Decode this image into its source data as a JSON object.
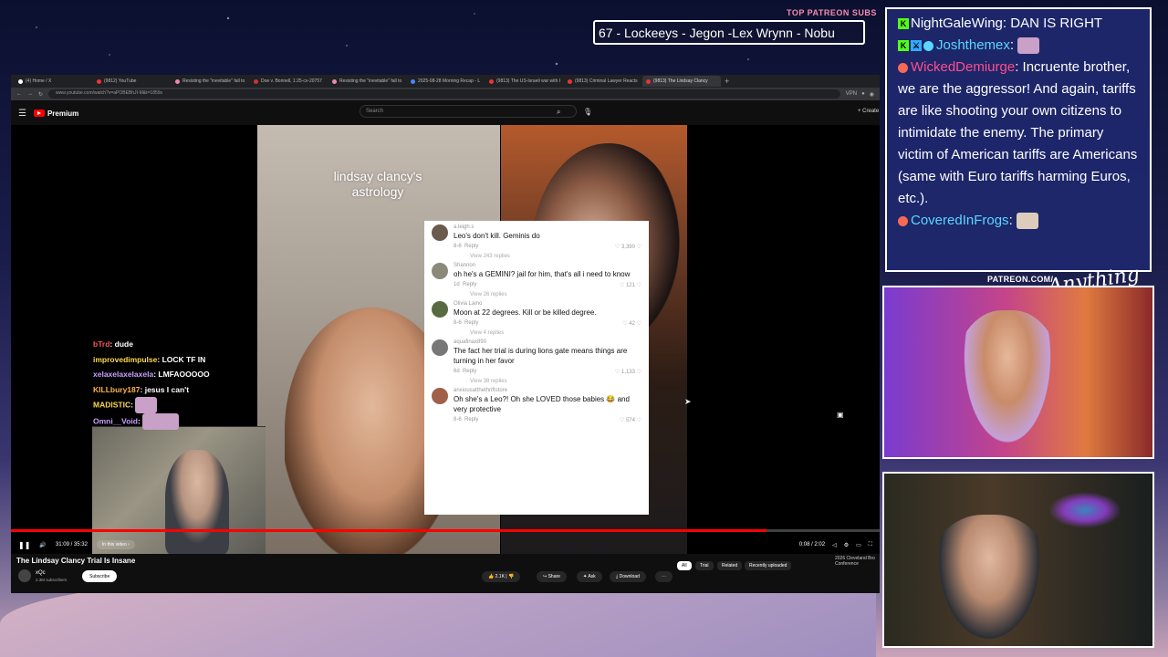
{
  "overlay": {
    "patreon_top_label": "TOP PATREON SUBS",
    "marquee_text": "67 - Lockeeys - Jegon -Lex Wrynn - Nobu",
    "patreon_url": "PATREON.COM/",
    "brand_script": "Anything Else?"
  },
  "browser": {
    "tabs": [
      {
        "label": "(4) Home / X"
      },
      {
        "label": "(9812) YouTube"
      },
      {
        "label": "Resisting the \"inevitable\" fall to"
      },
      {
        "label": "Doe v. Bonnell, 1:25-cv-20757"
      },
      {
        "label": "Resisting the \"inevitable\" fall to"
      },
      {
        "label": "2025-08-28 Morning Recap - L"
      },
      {
        "label": "(9813) The US-Israeli war with I"
      },
      {
        "label": "(9813) Criminal Lawyer Reacts"
      },
      {
        "label": "(9813) The Lindsay Clancy"
      }
    ],
    "url": "www.youtube.com/watch?v=aPOBEBhJI-M&t=1859s",
    "vpn_label": "VPN"
  },
  "youtube": {
    "logo_label": "Premium",
    "search_placeholder": "Search",
    "create_label": "Create",
    "video_title": "The Lindsay Clancy Trial Is Insane",
    "channel_name": "xQc",
    "channel_subs": "2.3M subscribers",
    "subscribe_label": "Subscribe",
    "likes": "2.1K",
    "share_label": "Share",
    "ask_label": "Ask",
    "download_label": "Download",
    "chips": [
      "All",
      "Trial",
      "Related",
      "Recently uploaded"
    ],
    "side_card_text": "2026 Cleveland Bro Conference",
    "player": {
      "time_left": "31:09 / 35:32",
      "in_this_video": "In this video",
      "time_right": "0:08 / 2:02",
      "progress": 0.87
    }
  },
  "video_frame": {
    "overlay_title": "lindsay clancy's astrology",
    "comments": [
      {
        "user": "a.leigh.s",
        "text": "Leo's don't kill. Geminis do",
        "date": "8-6",
        "likes": "3,390",
        "replies": "View 243 replies"
      },
      {
        "user": "Shannon",
        "text": "oh he's a GEMINI? jail for him, that's all i need to know",
        "date": "1d",
        "likes": "121",
        "replies": "View 26 replies"
      },
      {
        "user": "Olivia Laino",
        "text": "Moon at 22 degrees. Kill or be killed degree.",
        "date": "8-6",
        "likes": "42",
        "replies": "View 4 replies"
      },
      {
        "user": "aquafinax890",
        "text": "The fact her trial is during lions gate means things are turning in her favor",
        "date": "6d",
        "likes": "1,133",
        "replies": "View 38 replies"
      },
      {
        "user": "anxiousatthethriftstore",
        "text": "Oh she's a Leo?! Oh she LOVED those babies 😂 and very protective",
        "date": "8-6",
        "likes": "574",
        "replies": ""
      }
    ],
    "reply_label": "Reply"
  },
  "twitch_chat": [
    {
      "user": "bTrd",
      "text": "dude"
    },
    {
      "user": "improvedimpulse",
      "text": "LOCK TF IN"
    },
    {
      "user": "xelaxelaxelaxela",
      "text": "LMFAOOOOO"
    },
    {
      "user": "KILLbury187",
      "text": "jesus I can't"
    },
    {
      "user": "MADISTIC",
      "text": ""
    },
    {
      "user": "Omni__Void",
      "text": ""
    }
  ],
  "side_chat": [
    {
      "user": "NightGaleWing",
      "text": "DAN IS RIGHT",
      "user_color": "#ffffff",
      "badges": [
        "kick"
      ]
    },
    {
      "user": "Joshthemex",
      "text": "",
      "user_color": "#5ad7ff",
      "badges": [
        "kick",
        "mod"
      ]
    },
    {
      "user": "WickedDemiurge",
      "text": "Incruente brother, we are the aggressor! And again, tariffs are like shooting your own citizens to intimidate the enemy. The primary victim of American tariffs are Americans (same with Euro tariffs harming Euros, etc.).",
      "user_color": "#ff4d8d",
      "badges": [
        "patreon"
      ]
    },
    {
      "user": "CoveredInFrogs",
      "text": "",
      "user_color": "#5ad7ff",
      "badges": [
        "patreon"
      ]
    }
  ]
}
